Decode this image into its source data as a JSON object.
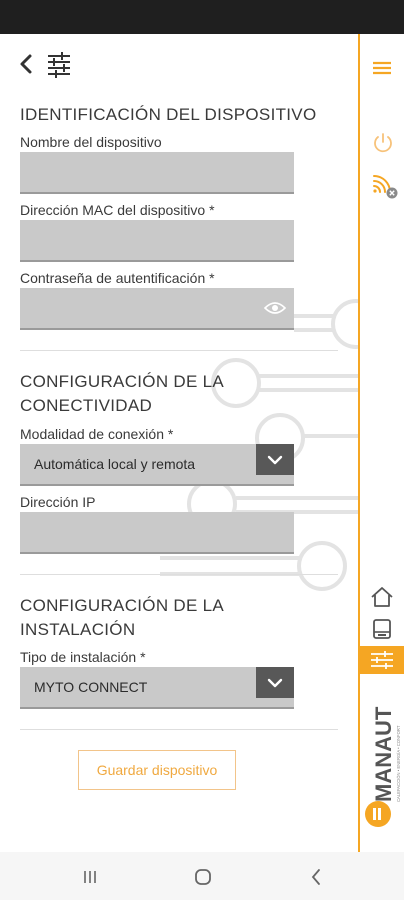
{
  "form": {
    "section_device": "IDENTIFICACIÓN DEL DISPOSITIVO",
    "device_name_label": "Nombre del dispositivo",
    "device_name_value": "",
    "mac_label": "Dirección MAC del dispositivo *",
    "mac_value": "",
    "password_label": "Contraseña de autentificación *",
    "password_value": "",
    "section_connectivity_line1": "CONFIGURACIÓN DE LA",
    "section_connectivity_line2": "CONECTIVIDAD",
    "connection_mode_label": "Modalidad de conexión *",
    "connection_mode_value": "Automática local y remota",
    "ip_label": "Dirección IP",
    "ip_value": "",
    "section_installation_line1": "CONFIGURACIÓN DE LA",
    "section_installation_line2": "INSTALACIÓN",
    "installation_type_label": "Tipo de instalación *",
    "installation_type_value": "MYTO CONNECT",
    "save_label": "Guardar dispositivo"
  },
  "brand": {
    "name": "MANAUT",
    "tagline": "CALEFACCIÓN • ENERGÍA • CONFORT"
  },
  "colors": {
    "accent": "#f5a623",
    "field_bg": "#c9c9c9",
    "dropdown_arrow_bg": "#585858"
  },
  "icons": {
    "back": "chevron-left-icon",
    "filter": "sliders-icon",
    "menu": "hamburger-menu-icon",
    "power": "power-icon",
    "wifi": "wifi-off-icon",
    "home": "home-icon",
    "tablet": "tablet-icon",
    "settings": "sliders-icon",
    "eye": "eye-icon"
  }
}
